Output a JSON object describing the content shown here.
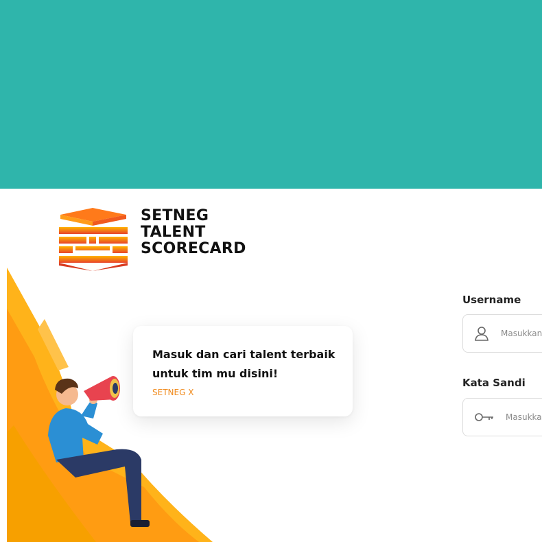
{
  "brand": {
    "line1": "SETNEG",
    "line2": "TALENT",
    "line3": "SCORECARD"
  },
  "card": {
    "title": "Masuk dan cari talent terbaik untuk tim mu disini!",
    "subtitle": "SETNEG X"
  },
  "form": {
    "username_label": "Username",
    "username_placeholder": "Masukkan username",
    "password_label": "Kata Sandi",
    "password_placeholder": "Masukkan kata sandi"
  },
  "colors": {
    "top_band": "#2fb5ab",
    "accent_orange": "#f08a1c",
    "logo_red": "#e8432a"
  },
  "icons": {
    "username": "user-icon",
    "password": "key-icon"
  }
}
